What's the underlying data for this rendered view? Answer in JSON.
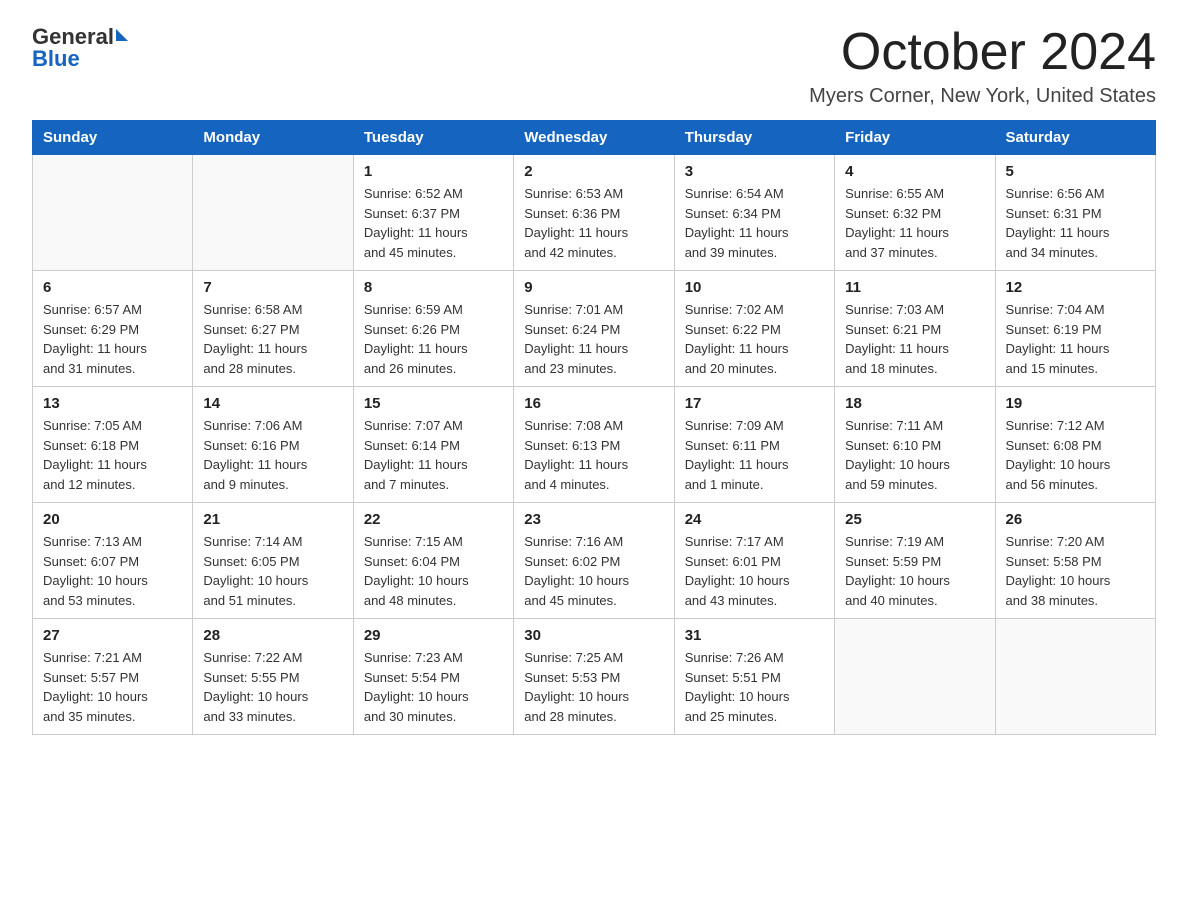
{
  "logo": {
    "general": "General",
    "blue": "Blue",
    "arrow": "▶"
  },
  "title": "October 2024",
  "location": "Myers Corner, New York, United States",
  "days_of_week": [
    "Sunday",
    "Monday",
    "Tuesday",
    "Wednesday",
    "Thursday",
    "Friday",
    "Saturday"
  ],
  "weeks": [
    [
      {
        "day": "",
        "info": ""
      },
      {
        "day": "",
        "info": ""
      },
      {
        "day": "1",
        "info": "Sunrise: 6:52 AM\nSunset: 6:37 PM\nDaylight: 11 hours\nand 45 minutes."
      },
      {
        "day": "2",
        "info": "Sunrise: 6:53 AM\nSunset: 6:36 PM\nDaylight: 11 hours\nand 42 minutes."
      },
      {
        "day": "3",
        "info": "Sunrise: 6:54 AM\nSunset: 6:34 PM\nDaylight: 11 hours\nand 39 minutes."
      },
      {
        "day": "4",
        "info": "Sunrise: 6:55 AM\nSunset: 6:32 PM\nDaylight: 11 hours\nand 37 minutes."
      },
      {
        "day": "5",
        "info": "Sunrise: 6:56 AM\nSunset: 6:31 PM\nDaylight: 11 hours\nand 34 minutes."
      }
    ],
    [
      {
        "day": "6",
        "info": "Sunrise: 6:57 AM\nSunset: 6:29 PM\nDaylight: 11 hours\nand 31 minutes."
      },
      {
        "day": "7",
        "info": "Sunrise: 6:58 AM\nSunset: 6:27 PM\nDaylight: 11 hours\nand 28 minutes."
      },
      {
        "day": "8",
        "info": "Sunrise: 6:59 AM\nSunset: 6:26 PM\nDaylight: 11 hours\nand 26 minutes."
      },
      {
        "day": "9",
        "info": "Sunrise: 7:01 AM\nSunset: 6:24 PM\nDaylight: 11 hours\nand 23 minutes."
      },
      {
        "day": "10",
        "info": "Sunrise: 7:02 AM\nSunset: 6:22 PM\nDaylight: 11 hours\nand 20 minutes."
      },
      {
        "day": "11",
        "info": "Sunrise: 7:03 AM\nSunset: 6:21 PM\nDaylight: 11 hours\nand 18 minutes."
      },
      {
        "day": "12",
        "info": "Sunrise: 7:04 AM\nSunset: 6:19 PM\nDaylight: 11 hours\nand 15 minutes."
      }
    ],
    [
      {
        "day": "13",
        "info": "Sunrise: 7:05 AM\nSunset: 6:18 PM\nDaylight: 11 hours\nand 12 minutes."
      },
      {
        "day": "14",
        "info": "Sunrise: 7:06 AM\nSunset: 6:16 PM\nDaylight: 11 hours\nand 9 minutes."
      },
      {
        "day": "15",
        "info": "Sunrise: 7:07 AM\nSunset: 6:14 PM\nDaylight: 11 hours\nand 7 minutes."
      },
      {
        "day": "16",
        "info": "Sunrise: 7:08 AM\nSunset: 6:13 PM\nDaylight: 11 hours\nand 4 minutes."
      },
      {
        "day": "17",
        "info": "Sunrise: 7:09 AM\nSunset: 6:11 PM\nDaylight: 11 hours\nand 1 minute."
      },
      {
        "day": "18",
        "info": "Sunrise: 7:11 AM\nSunset: 6:10 PM\nDaylight: 10 hours\nand 59 minutes."
      },
      {
        "day": "19",
        "info": "Sunrise: 7:12 AM\nSunset: 6:08 PM\nDaylight: 10 hours\nand 56 minutes."
      }
    ],
    [
      {
        "day": "20",
        "info": "Sunrise: 7:13 AM\nSunset: 6:07 PM\nDaylight: 10 hours\nand 53 minutes."
      },
      {
        "day": "21",
        "info": "Sunrise: 7:14 AM\nSunset: 6:05 PM\nDaylight: 10 hours\nand 51 minutes."
      },
      {
        "day": "22",
        "info": "Sunrise: 7:15 AM\nSunset: 6:04 PM\nDaylight: 10 hours\nand 48 minutes."
      },
      {
        "day": "23",
        "info": "Sunrise: 7:16 AM\nSunset: 6:02 PM\nDaylight: 10 hours\nand 45 minutes."
      },
      {
        "day": "24",
        "info": "Sunrise: 7:17 AM\nSunset: 6:01 PM\nDaylight: 10 hours\nand 43 minutes."
      },
      {
        "day": "25",
        "info": "Sunrise: 7:19 AM\nSunset: 5:59 PM\nDaylight: 10 hours\nand 40 minutes."
      },
      {
        "day": "26",
        "info": "Sunrise: 7:20 AM\nSunset: 5:58 PM\nDaylight: 10 hours\nand 38 minutes."
      }
    ],
    [
      {
        "day": "27",
        "info": "Sunrise: 7:21 AM\nSunset: 5:57 PM\nDaylight: 10 hours\nand 35 minutes."
      },
      {
        "day": "28",
        "info": "Sunrise: 7:22 AM\nSunset: 5:55 PM\nDaylight: 10 hours\nand 33 minutes."
      },
      {
        "day": "29",
        "info": "Sunrise: 7:23 AM\nSunset: 5:54 PM\nDaylight: 10 hours\nand 30 minutes."
      },
      {
        "day": "30",
        "info": "Sunrise: 7:25 AM\nSunset: 5:53 PM\nDaylight: 10 hours\nand 28 minutes."
      },
      {
        "day": "31",
        "info": "Sunrise: 7:26 AM\nSunset: 5:51 PM\nDaylight: 10 hours\nand 25 minutes."
      },
      {
        "day": "",
        "info": ""
      },
      {
        "day": "",
        "info": ""
      }
    ]
  ]
}
